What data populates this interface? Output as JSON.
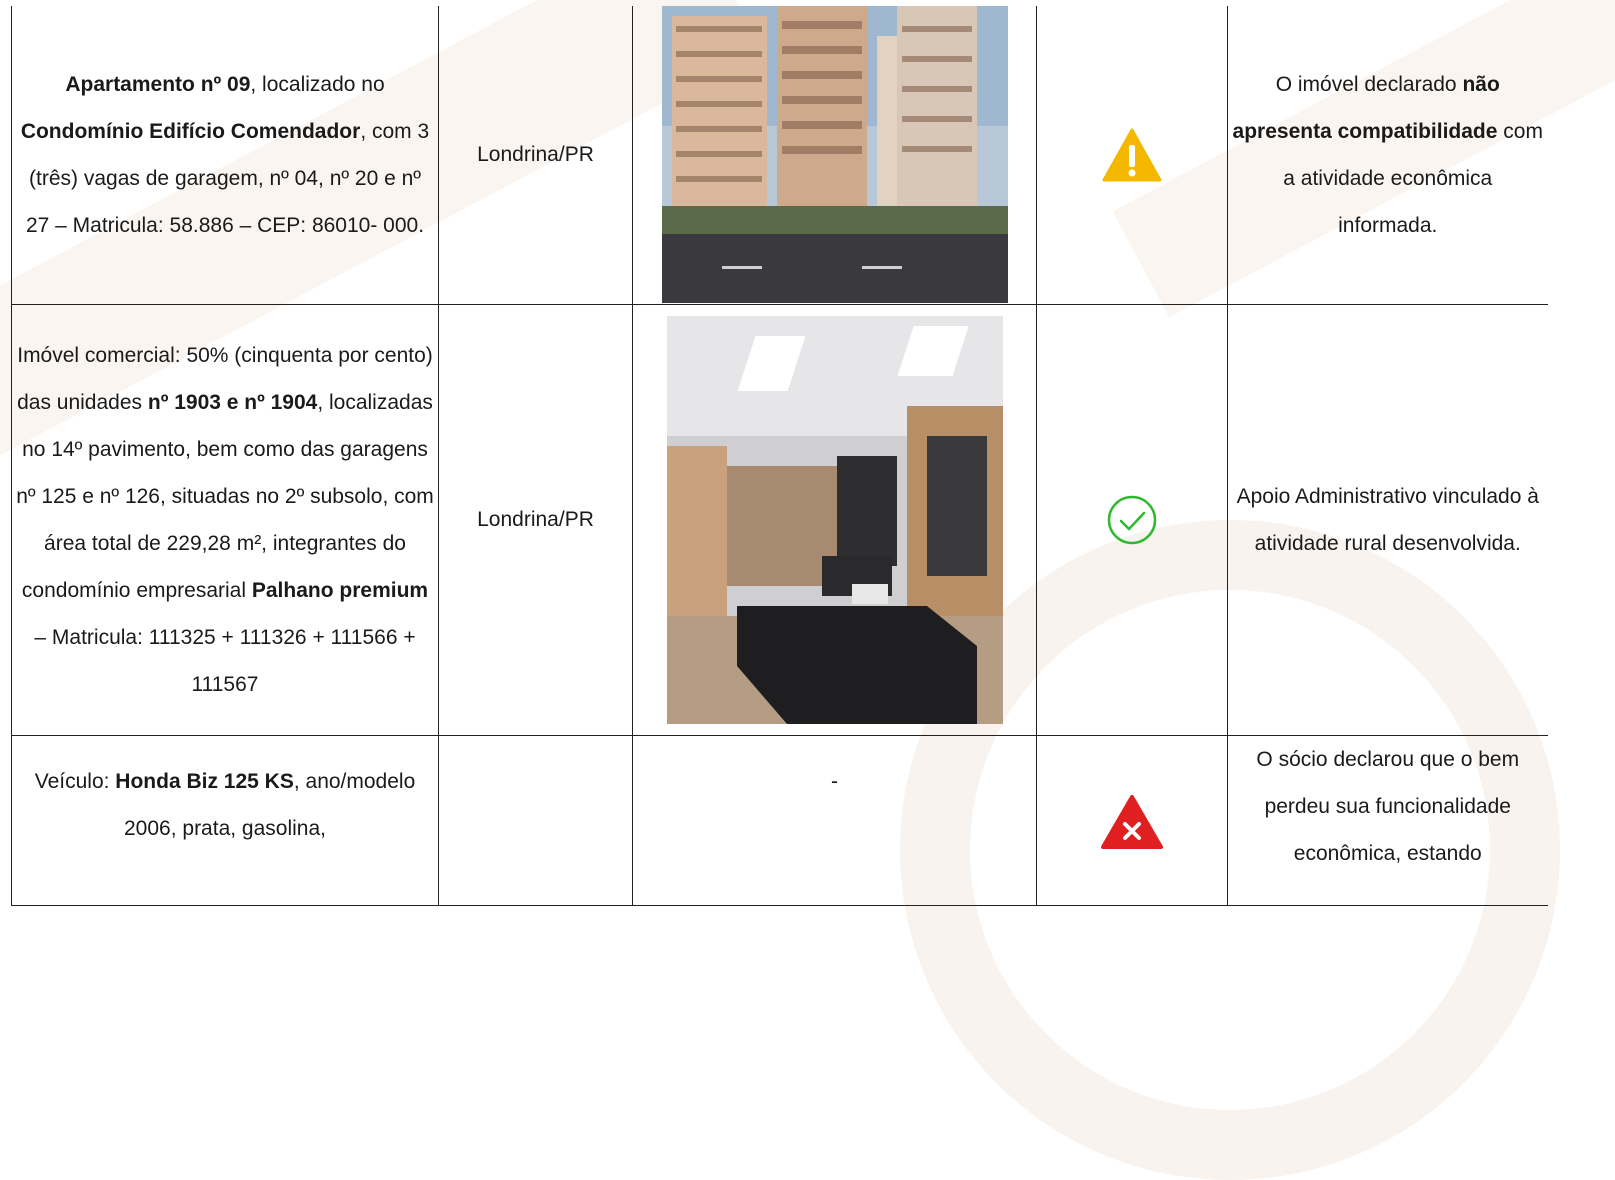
{
  "rows": [
    {
      "description": [
        {
          "t": "Apartamento nº 09",
          "b": true
        },
        {
          "t": ", localizado no ",
          "b": false
        },
        {
          "t": "Condomínio Edifício Comendador",
          "b": true
        },
        {
          "t": ", com 3 (três) vagas de garagem, nº 04, nº 20 e nº 27 – Matricula: 58.886 – CEP: 86010- 000.",
          "b": false
        }
      ],
      "city": "Londrina/PR",
      "photo": "building-exterior-photo",
      "status_icon": "warning-icon",
      "status_color": "#F5B800",
      "note": [
        {
          "t": "O imóvel declarado ",
          "b": false
        },
        {
          "t": "não apresenta compatibilidade",
          "b": true
        },
        {
          "t": " com a atividade econômica informada.",
          "b": false
        }
      ]
    },
    {
      "description": [
        {
          "t": "Imóvel comercial: 50% (cinquenta por cento) das unidades ",
          "b": false
        },
        {
          "t": "nº 1903 e nº 1904",
          "b": true
        },
        {
          "t": ", localizadas no 14º pavimento, bem como das garagens nº 125 e nº 126, situadas no 2º subsolo, com área total de 229,28 m², integrantes do condomínio empresarial ",
          "b": false
        },
        {
          "t": "Palhano premium",
          "b": true
        },
        {
          "t": " – Matricula: 111325 + 111326 + 111566 + 111567",
          "b": false
        }
      ],
      "city": "Londrina/PR",
      "photo": "office-interior-photo",
      "status_icon": "check-circle-icon",
      "status_color": "#2EB82E",
      "note": [
        {
          "t": "Apoio Administrativo vinculado à atividade rural desenvolvida.",
          "b": false
        }
      ]
    },
    {
      "description": [
        {
          "t": "Veículo: ",
          "b": false
        },
        {
          "t": "Honda Biz 125 KS",
          "b": true
        },
        {
          "t": ", ano/modelo 2006, prata, gasolina,",
          "b": false
        }
      ],
      "city": "",
      "photo_text": "-",
      "status_icon": "error-triangle-icon",
      "status_color": "#E02020",
      "note": [
        {
          "t": "O sócio declarou que o bem perdeu sua funcionalidade econômica, estando",
          "b": false
        }
      ]
    }
  ]
}
